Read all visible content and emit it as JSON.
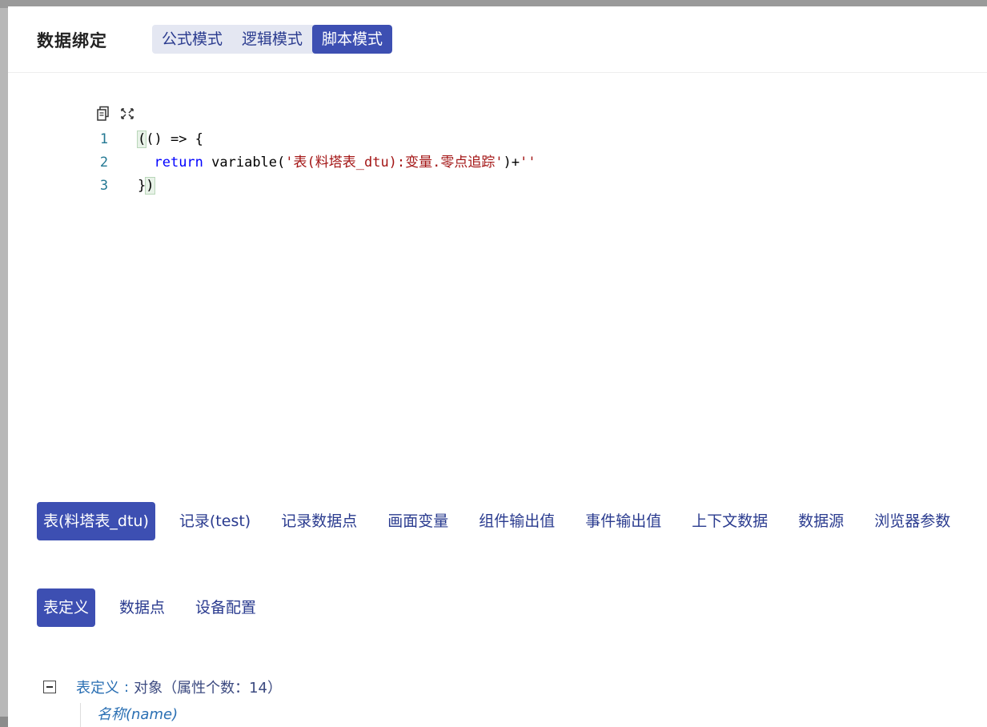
{
  "dialog": {
    "title": "数据绑定"
  },
  "mode_tabs": [
    {
      "label": "公式模式",
      "active": false
    },
    {
      "label": "逻辑模式",
      "active": false
    },
    {
      "label": "脚本模式",
      "active": true
    }
  ],
  "editor": {
    "tools": [
      "copy-icon",
      "fullscreen-icon"
    ],
    "lines": [
      {
        "no": "1"
      },
      {
        "no": "2"
      },
      {
        "no": "3"
      }
    ],
    "code": {
      "l1_open": "(",
      "l1_rest": "() => {",
      "l2_indent": "  ",
      "l2_keyword": "return",
      "l2_fn": " variable(",
      "l2_str": "'表(料塔表_dtu):变量.零点追踪'",
      "l2_plus": ")+",
      "l2_empty_str": "''",
      "l3_brace": "}",
      "l3_close": ")"
    }
  },
  "source_tabs": [
    {
      "label": "表(料塔表_dtu)",
      "active": true
    },
    {
      "label": "记录(test)",
      "active": false
    },
    {
      "label": "记录数据点",
      "active": false
    },
    {
      "label": "画面变量",
      "active": false
    },
    {
      "label": "组件输出值",
      "active": false
    },
    {
      "label": "事件输出值",
      "active": false
    },
    {
      "label": "上下文数据",
      "active": false
    },
    {
      "label": "数据源",
      "active": false
    },
    {
      "label": "浏览器参数",
      "active": false
    }
  ],
  "sub_tabs": [
    {
      "label": "表定义",
      "active": true
    },
    {
      "label": "数据点",
      "active": false
    },
    {
      "label": "设备配置",
      "active": false
    }
  ],
  "tree": {
    "root_key": "表定义",
    "root_sep": ":",
    "root_value": "对象（属性个数：14）",
    "child_label": "名称(name)"
  },
  "colors": {
    "accent": "#3d4fb2",
    "tab_text": "#2a3b8f",
    "line_number": "#237893",
    "keyword": "#0000ff",
    "string": "#a31515"
  }
}
